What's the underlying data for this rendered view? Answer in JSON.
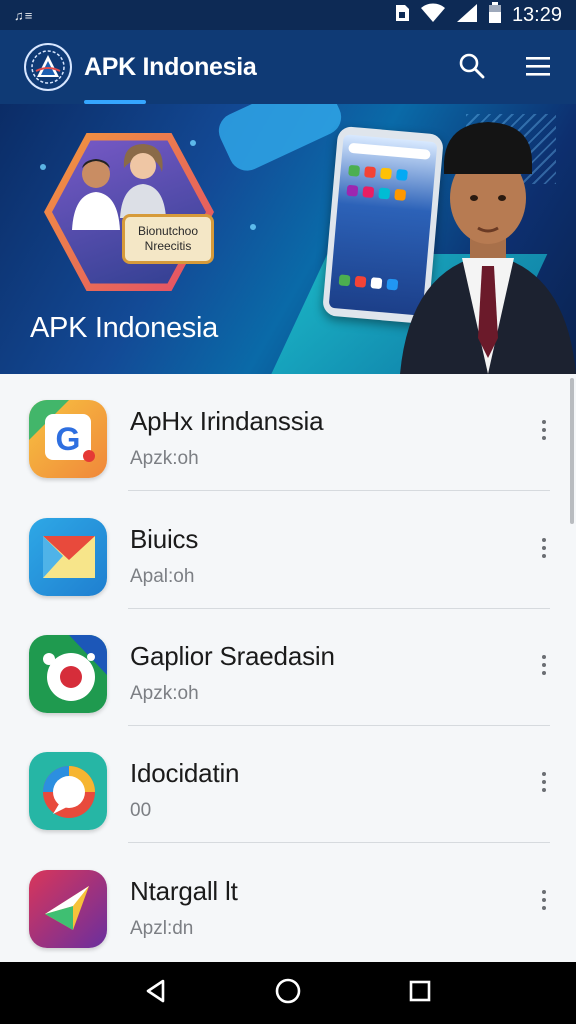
{
  "status_bar": {
    "left_text": "♫≡",
    "time": "13:29",
    "icons": [
      "sim-icon",
      "wifi-icon",
      "signal-icon",
      "battery-icon"
    ]
  },
  "app_bar": {
    "title": "APK Indonesia",
    "actions": [
      "search-icon",
      "menu-icon"
    ]
  },
  "banner": {
    "title": "APK Indonesia",
    "badge_line1": "Bionutchoo",
    "badge_line2": "Nreecitis"
  },
  "apps": [
    {
      "name": "ApHx Irindanssia",
      "sub": "Apzk:oh",
      "icon": "g-app-icon"
    },
    {
      "name": "Biuics",
      "sub": "Apal:oh",
      "icon": "envelope-app-icon"
    },
    {
      "name": "Gaplior Sraedasin",
      "sub": "Apzk:oh",
      "icon": "record-app-icon"
    },
    {
      "name": "Idocidatin",
      "sub": "00",
      "icon": "chat-app-icon"
    },
    {
      "name": "Ntargall lt",
      "sub": "Apzl:dn",
      "icon": "play-app-icon"
    }
  ],
  "colors": {
    "status_bar": "#0d2a55",
    "app_bar": "#0f3a75",
    "accent": "#35a6ff",
    "nav_bar": "#000000"
  }
}
